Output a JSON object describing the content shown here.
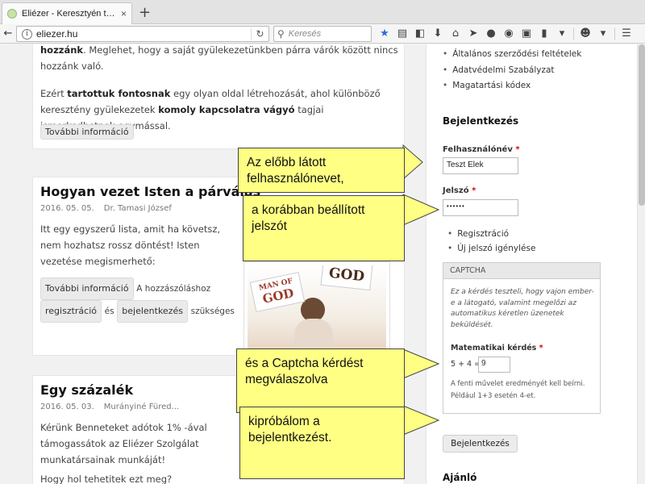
{
  "browser": {
    "tab_title": "Eliézer - Keresztyén társker...",
    "tab_close": "×",
    "new_tab": "+",
    "url": "eliezer.hu",
    "search_placeholder": "Keresés"
  },
  "main": {
    "card1": {
      "para1_bold": "hozzánk",
      "para1_rest": ". Meglehet, hogy a saját gyülekezetünkben párra várók között nincs hozzánk való.",
      "para2_a": "Ezért ",
      "para2_b": "tartottuk fontosnak",
      "para2_c": " egy olyan oldal létrehozását, ahol különböző keresztény gyülekezetek ",
      "para2_d": "komoly kapcsolatra vágyó",
      "para2_e": " tagjai ismerkedhetnek egymással.",
      "more": "További információ"
    },
    "post1": {
      "title": "Hogyan vezet Isten a párválas",
      "date": "2016. 05. 05.",
      "author": "Dr. Tamasi József",
      "excerpt": "Itt egy egyszerű lista, amit ha követsz, nem hozhatsz rossz döntést! Isten vezetése megismerhető:",
      "more": "További információ",
      "comment_pre": "A hozzászóláshoz",
      "register": "regisztráció",
      "and": "és",
      "login": "bejelentkezés",
      "needed": "szükséges",
      "image_sign1_top": "MAN OF",
      "image_sign1_bottom": "GOD",
      "image_sign2": "GOD"
    },
    "post2": {
      "title": "Egy százalék",
      "date": "2016. 05. 03.",
      "author": "Murányiné Füred...",
      "excerpt": "Kérünk Benneteket adótok 1% -ával támogassátok az Eliézer Szolgálat munkatársainak munkáját!",
      "more_line": "Hogy hol tehetitek ezt meg?"
    }
  },
  "sidebar": {
    "links": [
      "Általános szerződési feltételek",
      "Adatvédelmi Szabályzat",
      "Magatartási kódex"
    ],
    "login_title": "Bejelentkezés",
    "username_label": "Felhasználónév",
    "username_value": "Teszt Elek",
    "password_label": "Jelszó",
    "password_value": "••••••",
    "required_mark": "*",
    "sub_links": [
      "Regisztráció",
      "Új jelszó igénylése"
    ],
    "captcha": {
      "legend": "CAPTCHA",
      "description": "Ez a kérdés teszteli, hogy vajon ember-e a látogató, valamint megelőzi az automatikus kéretlen üzenetek beküldését.",
      "question_label": "Matematikai kérdés",
      "equation": "5 + 4 =",
      "answer": "9",
      "help1": "A fenti művelet eredményét kell beírni.",
      "help2": "Például 1+3 esetén 4-et."
    },
    "login_button": "Bejelentkezés",
    "next_title": "Ajánló"
  },
  "callouts": {
    "c1": "Az előbb látott felhasználónevet,",
    "c2": "a korábban beállított jelszót",
    "c3": "és a Captcha kérdést megválaszolva",
    "c4": "kipróbálom a bejelentkezést."
  },
  "colors": {
    "callout_fill": "#ffff84",
    "required": "#dd0000",
    "bookmark_star": "#2a6fd6"
  }
}
